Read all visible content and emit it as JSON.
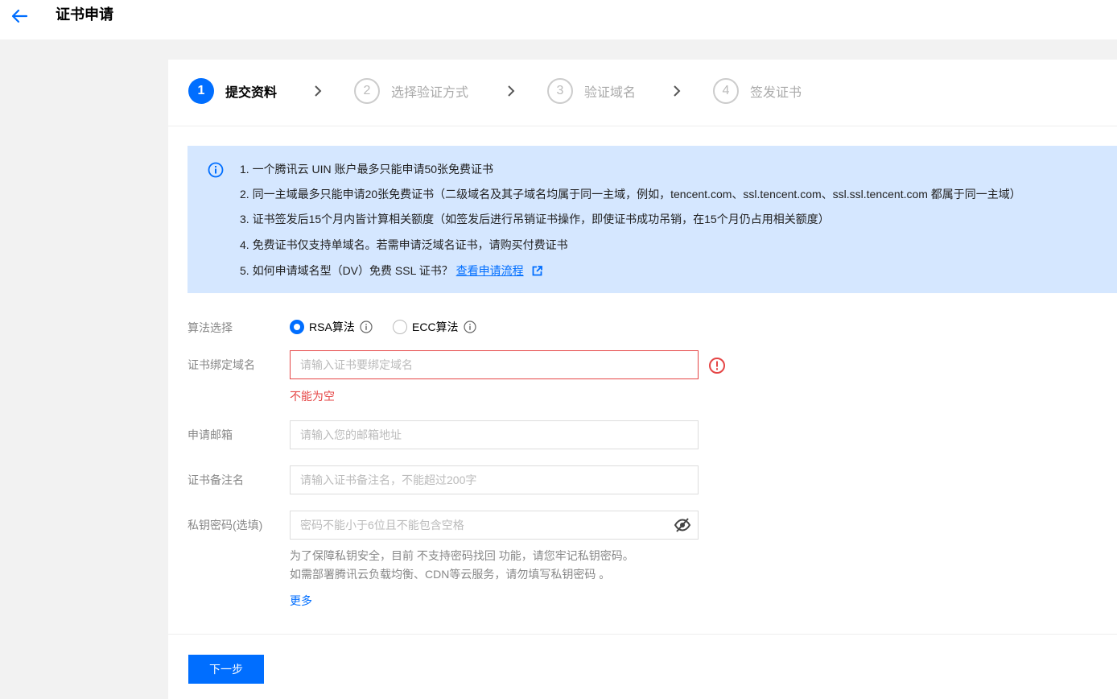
{
  "header": {
    "title": "证书申请"
  },
  "steps": [
    {
      "number": "1",
      "label": "提交资料"
    },
    {
      "number": "2",
      "label": "选择验证方式"
    },
    {
      "number": "3",
      "label": "验证域名"
    },
    {
      "number": "4",
      "label": "签发证书"
    }
  ],
  "notice": {
    "lines": [
      "1. 一个腾讯云 UIN 账户最多只能申请50张免费证书",
      "2. 同一主域最多只能申请20张免费证书（二级域名及其子域名均属于同一主域，例如，tencent.com、ssl.tencent.com、ssl.ssl.tencent.com 都属于同一主域）",
      "3. 证书签发后15个月内皆计算相关额度（如签发后进行吊销证书操作，即使证书成功吊销，在15个月仍占用相关额度）",
      "4. 免费证书仅支持单域名。若需申请泛域名证书，请购买付费证书",
      "5. 如何申请域名型（DV）免费 SSL 证书？"
    ],
    "link_label": "查看申请流程"
  },
  "form": {
    "algorithm": {
      "label": "算法选择",
      "options": [
        "RSA算法",
        "ECC算法"
      ],
      "selected": "RSA算法"
    },
    "domain": {
      "label": "证书绑定域名",
      "placeholder": "请输入证书要绑定域名",
      "error": "不能为空"
    },
    "email": {
      "label": "申请邮箱",
      "placeholder": "请输入您的邮箱地址"
    },
    "remark": {
      "label": "证书备注名",
      "placeholder": "请输入证书备注名，不能超过200字"
    },
    "password": {
      "label": "私钥密码(选填)",
      "placeholder": "密码不能小于6位且不能包含空格",
      "hint1": "为了保障私钥安全，目前 不支持密码找回 功能，请您牢记私钥密码。",
      "hint2": "如需部署腾讯云负载均衡、CDN等云服务，请勿填写私钥密码 。",
      "more": "更多"
    }
  },
  "footer": {
    "next_label": "下一步"
  },
  "colors": {
    "accent": "#006eff",
    "error": "#e54545",
    "notice_bg": "#d5e7ff"
  }
}
